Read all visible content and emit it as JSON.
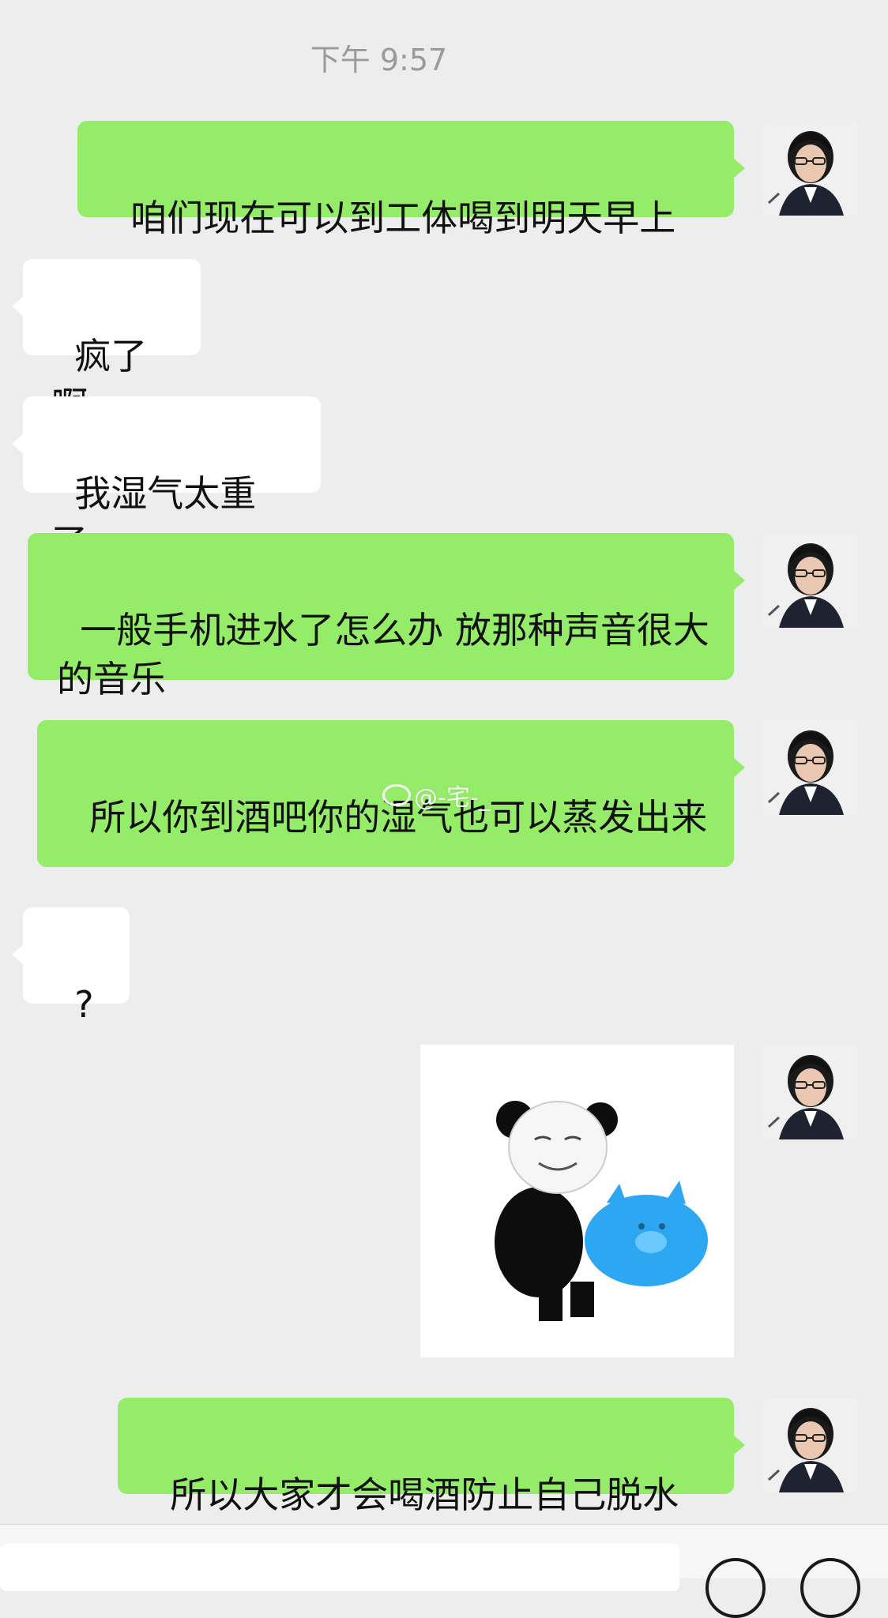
{
  "timestamp": "下午 9:57",
  "messages": [
    {
      "text": "咱们现在可以到工体喝到明天早上"
    },
    {
      "text": "疯了啊"
    },
    {
      "text": "我湿气太重了"
    },
    {
      "text": "一般手机进水了怎么办 放那种声音很大的音乐"
    },
    {
      "text": "所以你到酒吧你的湿气也可以蒸发出来"
    },
    {
      "text": "?"
    },
    {
      "text": "所以大家才会喝酒防止自己脱水"
    }
  ],
  "sticker": {
    "icon": "panda-meme-sticker"
  },
  "watermark": {
    "text": "@-宅-_",
    "icon": "weibo-icon"
  },
  "input_bar": {
    "icons": [
      "emoji-icon",
      "plus-icon"
    ]
  },
  "colors": {
    "background": "#ededed",
    "sent_bubble": "#95ec69",
    "received_bubble": "#ffffff"
  }
}
